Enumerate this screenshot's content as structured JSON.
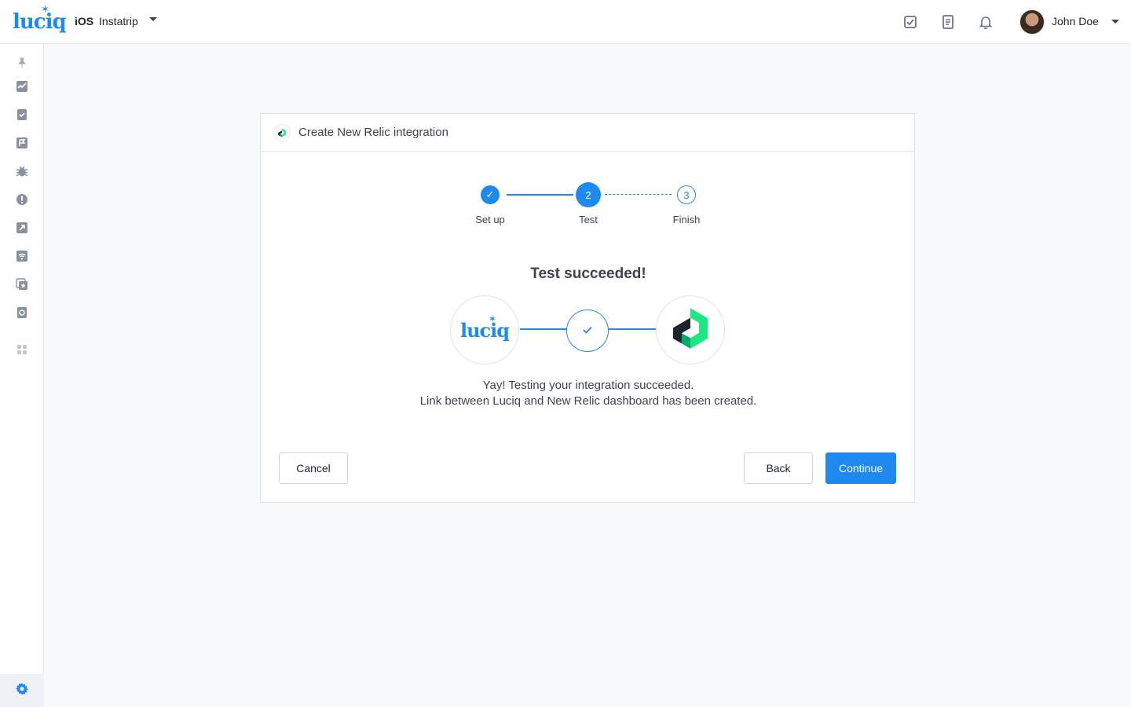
{
  "header": {
    "logo_text": "luciq",
    "platform": "iOS",
    "app_name": "Instatrip",
    "user_name": "John Doe",
    "icons": [
      "checklist-icon",
      "document-icon",
      "bell-icon"
    ]
  },
  "sidebar": {
    "items": [
      "pin-icon",
      "dashboard-icon",
      "reports-icon",
      "feedback-icon",
      "bug-icon",
      "crash-icon",
      "release-icon",
      "network-icon",
      "ratings-icon",
      "sessions-icon",
      "apps-grid-icon"
    ],
    "settings": "gear-icon"
  },
  "card": {
    "title": "Create New Relic integration",
    "steps": [
      {
        "label": "Set up",
        "marker": "✓",
        "state": "done"
      },
      {
        "label": "Test",
        "marker": "2",
        "state": "active"
      },
      {
        "label": "Finish",
        "marker": "3",
        "state": "next"
      }
    ],
    "success_title": "Test succeeded!",
    "source_logo": "luciq",
    "message_line1": "Yay! Testing your integration succeeded.",
    "message_line2": "Link between Luciq and New Relic dashboard has been created.",
    "buttons": {
      "cancel": "Cancel",
      "back": "Back",
      "continue": "Continue"
    }
  },
  "colors": {
    "accent": "#1e8af0",
    "newrelic_green": "#1ce783",
    "newrelic_dark": "#00ac69"
  }
}
